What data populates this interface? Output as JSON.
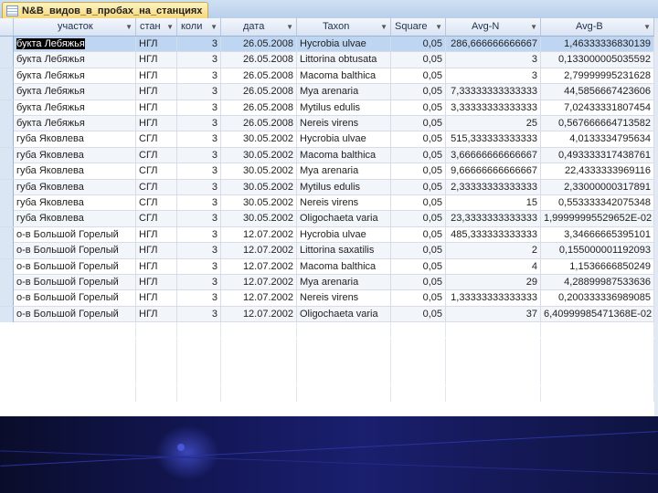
{
  "window": {
    "tab_title": "N&B_видов_в_пробах_на_станциях"
  },
  "table": {
    "columns": [
      "участок",
      "стан",
      "коли",
      "дата",
      "Taxon",
      "Square",
      "Avg-N",
      "Avg-B"
    ],
    "rows": [
      [
        "букта Лебяжья",
        "НГЛ",
        "3",
        "26.05.2008",
        "Hycrobia ulvae",
        "0,05",
        "286,666666666667",
        "1,46333336830139"
      ],
      [
        "букта Лебяжья",
        "НГЛ",
        "3",
        "26.05.2008",
        "Littorina obtusata",
        "0,05",
        "3",
        "0,133000005035592"
      ],
      [
        "букта Лебяжья",
        "НГЛ",
        "3",
        "26.05.2008",
        "Macoma balthica",
        "0,05",
        "3",
        "2,79999995231628"
      ],
      [
        "букта Лебяжья",
        "НГЛ",
        "3",
        "26.05.2008",
        "Mya arenaria",
        "0,05",
        "7,33333333333333",
        "44,5856667423606"
      ],
      [
        "букта Лебяжья",
        "НГЛ",
        "3",
        "26.05.2008",
        "Mytilus edulis",
        "0,05",
        "3,33333333333333",
        "7,02433331807454"
      ],
      [
        "букта Лебяжья",
        "НГЛ",
        "3",
        "26.05.2008",
        "Nereis virens",
        "0,05",
        "25",
        "0,567666664713582"
      ],
      [
        "губа Яковлева",
        "СГЛ",
        "3",
        "30.05.2002",
        "Hycrobia ulvae",
        "0,05",
        "515,333333333333",
        "4,0133334795634"
      ],
      [
        "губа Яковлева",
        "СГЛ",
        "3",
        "30.05.2002",
        "Macoma balthica",
        "0,05",
        "3,66666666666667",
        "0,493333317438761"
      ],
      [
        "губа Яковлева",
        "СГЛ",
        "3",
        "30.05.2002",
        "Mya arenaria",
        "0,05",
        "9,66666666666667",
        "22,4333333969116"
      ],
      [
        "губа Яковлева",
        "СГЛ",
        "3",
        "30.05.2002",
        "Mytilus edulis",
        "0,05",
        "2,33333333333333",
        "2,33000000317891"
      ],
      [
        "губа Яковлева",
        "СГЛ",
        "3",
        "30.05.2002",
        "Nereis virens",
        "0,05",
        "15",
        "0,553333342075348"
      ],
      [
        "губа Яковлева",
        "СГЛ",
        "3",
        "30.05.2002",
        "Oligochaeta varia",
        "0,05",
        "23,3333333333333",
        "1,99999995529652E-02"
      ],
      [
        "о-в Большой Горелый",
        "НГЛ",
        "3",
        "12.07.2002",
        "Hycrobia ulvae",
        "0,05",
        "485,333333333333",
        "3,34666665395101"
      ],
      [
        "о-в Большой Горелый",
        "НГЛ",
        "3",
        "12.07.2002",
        "Littorina saxatilis",
        "0,05",
        "2",
        "0,155000001192093"
      ],
      [
        "о-в Большой Горелый",
        "НГЛ",
        "3",
        "12.07.2002",
        "Macoma balthica",
        "0,05",
        "4",
        "1,1536666850249"
      ],
      [
        "о-в Большой Горелый",
        "НГЛ",
        "3",
        "12.07.2002",
        "Mya arenaria",
        "0,05",
        "29",
        "4,28899987533636"
      ],
      [
        "о-в Большой Горелый",
        "НГЛ",
        "3",
        "12.07.2002",
        "Nereis virens",
        "0,05",
        "1,33333333333333",
        "0,200333336989085"
      ],
      [
        "о-в Большой Горелый",
        "НГЛ",
        "3",
        "12.07.2002",
        "Oligochaeta varia",
        "0,05",
        "37",
        "6,40999985471368E-02"
      ]
    ]
  },
  "icons": {
    "table_icon": "table-icon",
    "dropdown": "dropdown-arrow-icon"
  }
}
